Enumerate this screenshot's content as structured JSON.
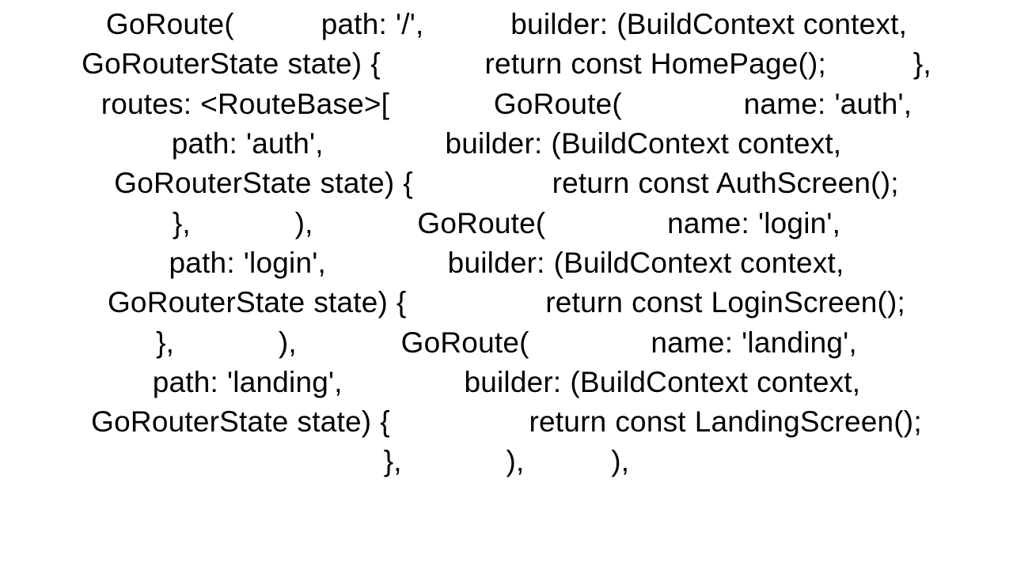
{
  "code": {
    "text": "GoRoute(          path: '/',          builder: (BuildContext context, GoRouterState state) {            return const HomePage();          },          routes: <RouteBase>[            GoRoute(              name: 'auth',              path: 'auth',              builder: (BuildContext context, GoRouterState state) {                return const AuthScreen();              },            ),            GoRoute(              name: 'login',              path: 'login',              builder: (BuildContext context, GoRouterState state) {                return const LoginScreen();              },            ),            GoRoute(              name: 'landing',              path: 'landing',              builder: (BuildContext context, GoRouterState state) {                return const LandingScreen();              },            ),          ),"
  }
}
